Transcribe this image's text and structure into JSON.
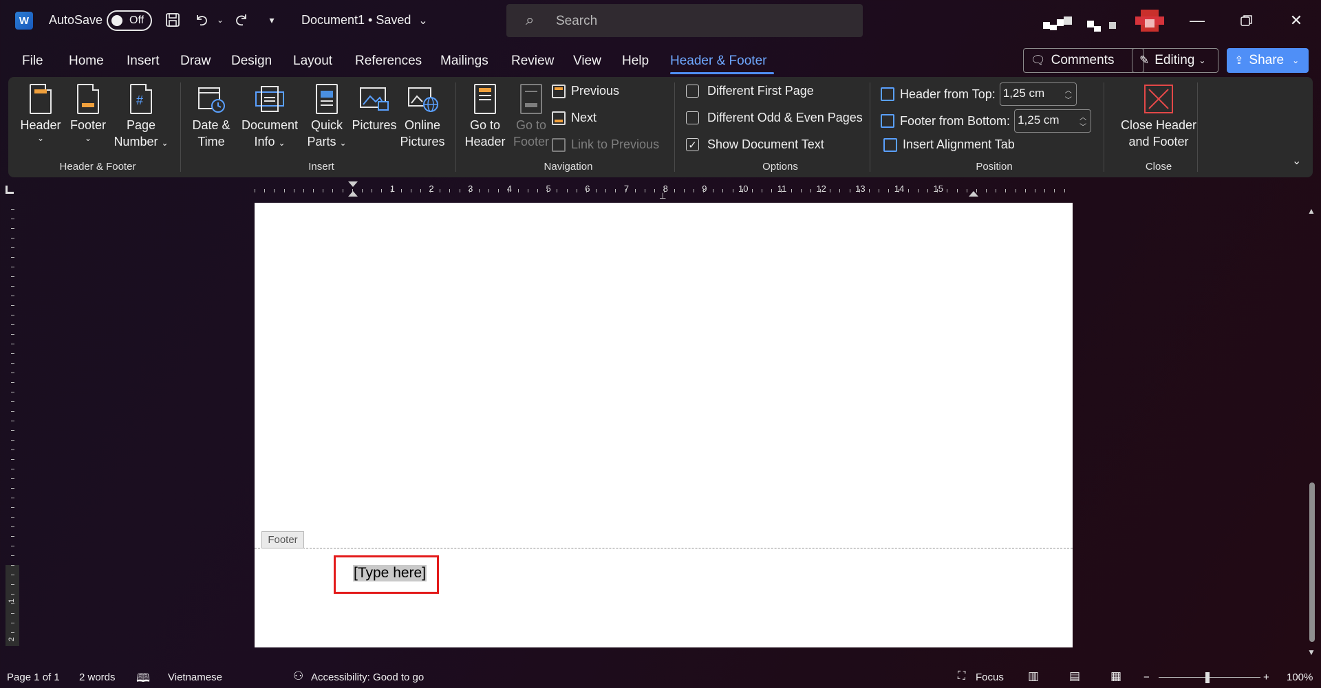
{
  "titlebar": {
    "app_icon": "W",
    "autosave_label": "AutoSave",
    "autosave_state": "Off",
    "document_title": "Document1 • Saved",
    "search_placeholder": "Search"
  },
  "menu": {
    "tabs": [
      "File",
      "Home",
      "Insert",
      "Draw",
      "Design",
      "Layout",
      "References",
      "Mailings",
      "Review",
      "View",
      "Help",
      "Header & Footer"
    ],
    "active_tab": "Header & Footer",
    "comments_label": "Comments",
    "editing_label": "Editing",
    "share_label": "Share"
  },
  "ribbon": {
    "group_header_footer": {
      "label": "Header & Footer",
      "header": "Header",
      "footer": "Footer",
      "page": "Page",
      "number": "Number"
    },
    "group_insert": {
      "label": "Insert",
      "date1": "Date &",
      "date2": "Time",
      "doc1": "Document",
      "doc2": "Info",
      "quick1": "Quick",
      "quick2": "Parts",
      "pictures": "Pictures",
      "online1": "Online",
      "online2": "Pictures"
    },
    "group_navigation": {
      "label": "Navigation",
      "goto_header1": "Go to",
      "goto_header2": "Header",
      "goto_footer1": "Go to",
      "goto_footer2": "Footer",
      "previous": "Previous",
      "next": "Next",
      "link_previous": "Link to Previous"
    },
    "group_options": {
      "label": "Options",
      "different_first": "Different First Page",
      "different_odd_even": "Different Odd & Even Pages",
      "show_doc_text": "Show Document Text",
      "show_doc_text_checked": true
    },
    "group_position": {
      "label": "Position",
      "header_from_top": "Header from Top:",
      "header_value": "1,25 cm",
      "footer_from_bottom": "Footer from Bottom:",
      "footer_value": "1,25 cm",
      "insert_alignment_tab": "Insert Alignment Tab"
    },
    "group_close": {
      "label": "Close",
      "close1": "Close Header",
      "close2": "and Footer"
    }
  },
  "ruler": {
    "numbers": [
      "1",
      "2",
      "3",
      "4",
      "5",
      "6",
      "7",
      "8",
      "9",
      "10",
      "11",
      "12",
      "13",
      "14",
      "15"
    ],
    "vertical_numbers": [
      "1",
      "2"
    ]
  },
  "document": {
    "footer_tag": "Footer",
    "footer_placeholder": "[Type here]"
  },
  "statusbar": {
    "page": "Page 1 of 1",
    "words": "2 words",
    "language": "Vietnamese",
    "accessibility": "Accessibility: Good to go",
    "focus": "Focus",
    "zoom": "100%",
    "zoom_minus": "−",
    "zoom_plus": "+"
  },
  "colors": {
    "accent": "#4f8ff7",
    "active_tab": "#6ea8ff",
    "highlight_border": "#e31b1b",
    "ribbon_bg": "#2b2b2b"
  },
  "icons": [
    "word-app-icon",
    "save-icon",
    "undo-icon",
    "redo-icon",
    "customize-icon",
    "search-icon",
    "minimize-icon",
    "restore-icon",
    "close-icon",
    "comment-icon",
    "pencil-icon",
    "share-icon"
  ]
}
